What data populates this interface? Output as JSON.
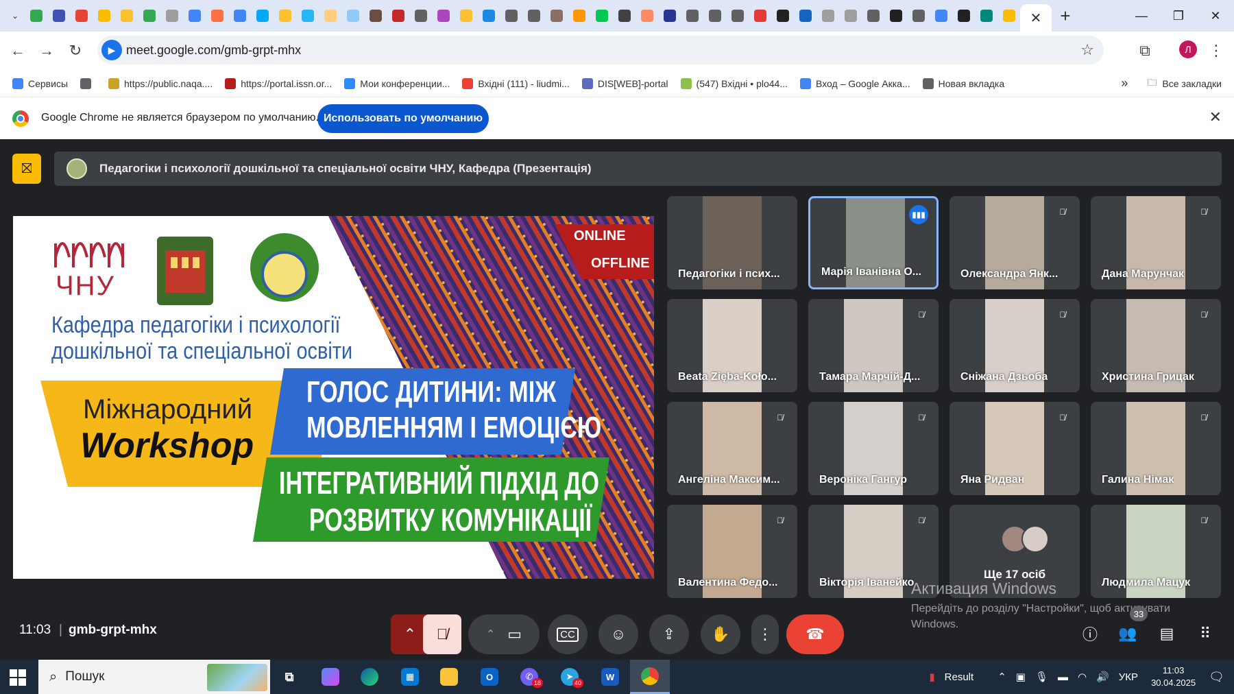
{
  "browser": {
    "tab_icon_colors": [
      "#34a853",
      "#3f51b5",
      "#ea4335",
      "#fbbc05",
      "#fbc02d",
      "#34a853",
      "#9e9e9e",
      "#4285f4",
      "#ff7043",
      "#4285f4",
      "#03a9f4",
      "#fbc02d",
      "#29b6f6",
      "#ffcc80",
      "#90caf9",
      "#6d4c41",
      "#c62828",
      "#616161",
      "#ab47bc",
      "#fbc02d",
      "#1e88e5",
      "#616161",
      "#616161",
      "#8d6e63",
      "#ff9800",
      "#00c853",
      "#424242",
      "#ff8a65",
      "#283593",
      "#616161",
      "#616161",
      "#616161",
      "#e53935",
      "#212121",
      "#1565c0",
      "#9e9e9e",
      "#9e9e9e",
      "#616161",
      "#212121",
      "#616161",
      "#4285f4",
      "#212121",
      "#00897b",
      "#fbbc05"
    ],
    "active_tab_icon": "close-icon",
    "url": "meet.google.com/gmb-grpt-mhx",
    "avatar_letter": "Л",
    "bookmarks": [
      {
        "label": "Сервисы",
        "color": "#4285f4"
      },
      {
        "label": "",
        "color": "#5f6368"
      },
      {
        "label": "https://public.naqa....",
        "color": "#c9a227"
      },
      {
        "label": "https://portal.issn.or...",
        "color": "#b71c1c"
      },
      {
        "label": "Мои конференции...",
        "color": "#2d8cff"
      },
      {
        "label": "Вхідні (111) - liudmi...",
        "color": "#ea4335"
      },
      {
        "label": "DIS[WEB]-portal",
        "color": "#5c6bc0"
      },
      {
        "label": "(547) Вхідні • plo44...",
        "color": "#8bc34a"
      },
      {
        "label": "Вход – Google Акка...",
        "color": "#4285f4"
      },
      {
        "label": "Новая вкладка",
        "color": "#616161"
      }
    ],
    "more_bookmarks": "»",
    "all_bookmarks": "Все закладки"
  },
  "infobar": {
    "message": "Google Chrome не является браузером по умолчанию.",
    "button": "Использовать по умолчанию"
  },
  "meet": {
    "presentation_title": "Педагогіки і психології дошкільної та спеціальної освіти ЧНУ, Кафедра (Презентація)",
    "slide": {
      "university": "ЧНУ",
      "online": "ONLINE",
      "offline": "OFFLINE",
      "department_line1": "Кафедра педагогіки і психології",
      "department_line2": "дошкільної та спеціальної освіти",
      "event_line1": "Міжнародний",
      "event_line2": "Workshop",
      "topic_line1": "ГОЛОС ДИТИНИ: МІЖ",
      "topic_line2": "МОВЛЕННЯМ І ЕМОЦІЄЮ",
      "subtopic_line1": "ІНТЕГРАТИВНИЙ ПІДХІД ДО",
      "subtopic_line2": "РОЗВИТКУ КОМУНІКАЦІЇ"
    },
    "participants": [
      {
        "name": "Педагогіки і псих...",
        "speaking": false,
        "muted": false,
        "bg": "#6d625a"
      },
      {
        "name": "Марія Іванівна О...",
        "speaking": true,
        "muted": false,
        "bg": "#8a8f87"
      },
      {
        "name": "Олександра Янк...",
        "speaking": false,
        "muted": true,
        "bg": "#b6aa9c"
      },
      {
        "name": "Дана Марунчак",
        "speaking": false,
        "muted": true,
        "bg": "#c7b8ab"
      },
      {
        "name": "Beata Zięba-Koło...",
        "speaking": false,
        "muted": false,
        "bg": "#d9cfc7"
      },
      {
        "name": "Тамара Марчій-Д...",
        "speaking": false,
        "muted": true,
        "bg": "#cfc8c2"
      },
      {
        "name": "Сніжана Дзьоба",
        "speaking": false,
        "muted": true,
        "bg": "#d8cfc8"
      },
      {
        "name": "Христина Грицак",
        "speaking": false,
        "muted": true,
        "bg": "#c5bbb3"
      },
      {
        "name": "Ангеліна Максим...",
        "speaking": false,
        "muted": true,
        "bg": "#cdb9a6"
      },
      {
        "name": "Вероніка Гангур",
        "speaking": false,
        "muted": true,
        "bg": "#d3cfcb"
      },
      {
        "name": "Яна Ридван",
        "speaking": false,
        "muted": true,
        "bg": "#d6c8bb"
      },
      {
        "name": "Галина Німак",
        "speaking": false,
        "muted": true,
        "bg": "#cdbfae"
      },
      {
        "name": "Валентина Федо...",
        "speaking": false,
        "muted": true,
        "bg": "#c2a98f"
      },
      {
        "name": "Вікторія Іванейко",
        "speaking": false,
        "muted": true,
        "bg": "#d5cdc4"
      },
      {
        "name": "Ще 17 осіб",
        "speaking": false,
        "muted": false,
        "bg": "#3c4043",
        "more": true
      },
      {
        "name": "Людмила Мацук",
        "speaking": false,
        "muted": true,
        "bg": "#c9d4c3"
      }
    ],
    "time": "11:03",
    "separator": "|",
    "meeting_code": "gmb-grpt-mhx",
    "people_count": "33",
    "watermark_title": "Активация Windows",
    "watermark_text": "Перейдіть до розділу \"Настройки\", щоб активувати Windows."
  },
  "taskbar": {
    "search_placeholder": "Пошук",
    "result_label": "Result",
    "language": "УКР",
    "time": "11:03",
    "date": "30.04.2025",
    "viber_badge": "18",
    "telegram_badge": "40"
  }
}
